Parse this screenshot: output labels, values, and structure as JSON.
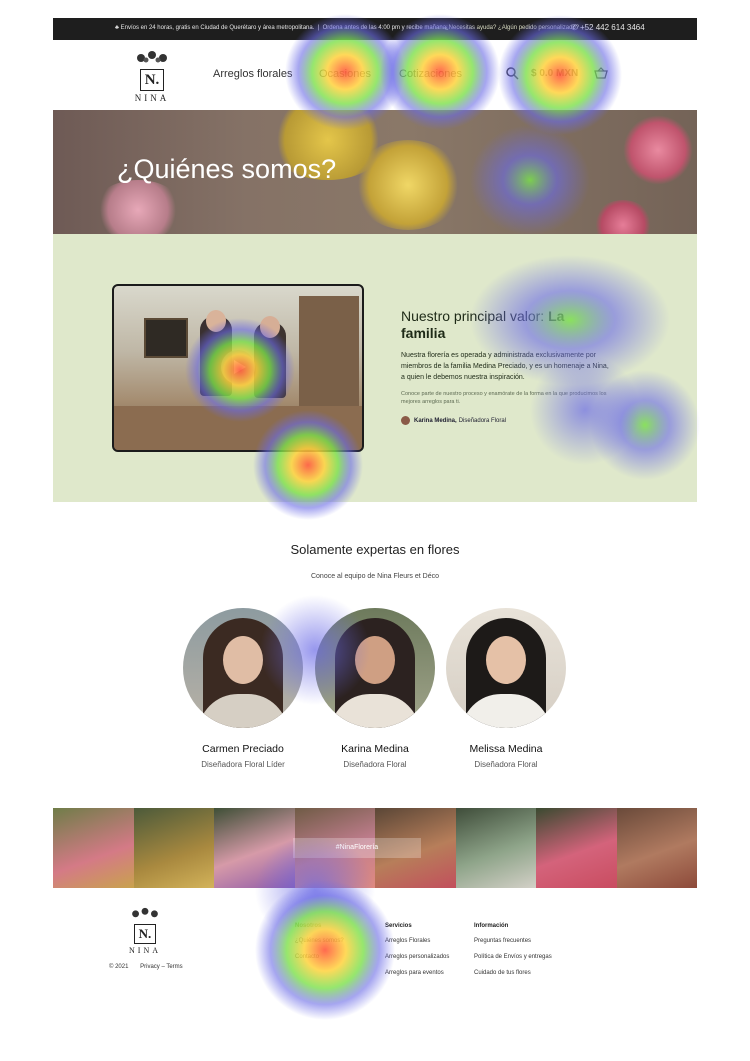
{
  "topbar": {
    "shipping": "Envíos en 24 horas, gratis en Ciudad de Querétaro y área metropolitana.",
    "order_note": "Ordena antes de las 4:00 pm y recibe mañana.",
    "help": "¿Necesitas ayuda? ¿Algún pedido personalizado?",
    "phone": "+52 442 614 3464"
  },
  "logo": {
    "mark": "N.",
    "word": "NINA"
  },
  "nav": {
    "items": [
      "Arreglos florales",
      "Ocasiones",
      "Cotizaciones"
    ],
    "cart_total": "$ 0.0 MXN"
  },
  "hero": {
    "title": "¿Quiénes somos?"
  },
  "value": {
    "title_prefix": "Nuestro principal valor: ",
    "title_strong": "La familia",
    "lead": "Nuestra florería es operada y administrada exclusivamente por miembros de la familia Medina Preciado, y es un homenaje a Nina, a quien le debemos nuestra inspiración.",
    "small": "Conoce parte de nuestro proceso y enamórate de la forma en la que producimos los mejores arreglos para ti.",
    "author_name": "Karina Medina,",
    "author_role": "Diseñadora Floral"
  },
  "team": {
    "title": "Solamente expertas en flores",
    "subtitle": "Conoce al equipo de Nina Fleurs et Déco",
    "members": [
      {
        "name": "Carmen Preciado",
        "role": "Diseñadora Floral Líder"
      },
      {
        "name": "Karina Medina",
        "role": "Diseñadora Floral"
      },
      {
        "name": "Melissa Medina",
        "role": "Diseñadora Floral"
      }
    ]
  },
  "gallery": {
    "tag": "#NinaFlorería"
  },
  "footer": {
    "copyright": "© 2021",
    "legal": "Privacy – Terms",
    "nosotros": {
      "heading": "Nosotros",
      "items": [
        "¿Quiénes somos?",
        "Contacto"
      ]
    },
    "servicios": {
      "heading": "Servicios",
      "items": [
        "Arreglos Florales",
        "Arreglos personalizados",
        "Arreglos para eventos"
      ]
    },
    "informacion": {
      "heading": "Información",
      "items": [
        "Preguntas frecuentes",
        "Política de Envíos y entregas",
        "Cuidado de tus flores"
      ]
    }
  },
  "colors": {
    "green_bg": "#dfe8cb",
    "topbar_bg": "#1e1e1e",
    "accent_green": "#6f8f2b"
  }
}
